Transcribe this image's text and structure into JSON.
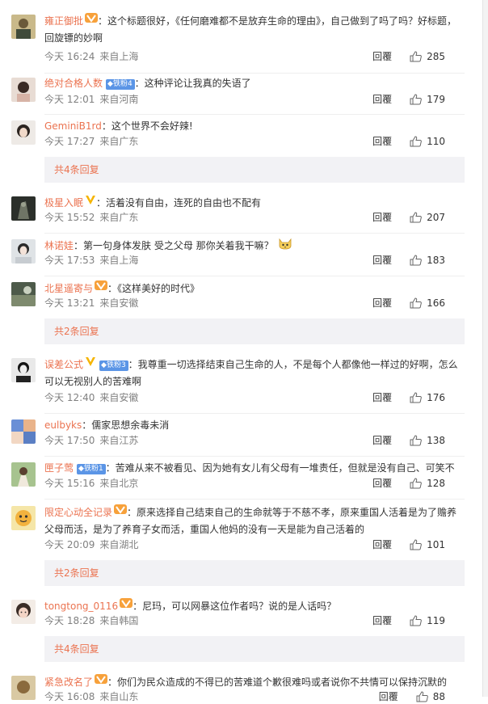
{
  "comments": [
    {
      "user": "雍正御批",
      "badge": "vip",
      "fan": "",
      "text": "：这个标题很好，《任何磨难都不是放弃生命的理由》，自己做到了吗了吗？好标题，",
      "text2": "回旋镖的妙啊",
      "time": "今天 16:24",
      "source": "来自上海",
      "reply": "回覆",
      "likes": "285",
      "avatar": "avatar-1"
    },
    {
      "user": "绝对合格人数",
      "badge": "",
      "fan": "铁粉4",
      "text": "：这种评论让我真的失语了",
      "text2": "",
      "time": "今天 12:01",
      "source": "来自河南",
      "reply": "回覆",
      "likes": "179",
      "avatar": "avatar-2"
    },
    {
      "user": "GeminiB1rd",
      "badge": "",
      "fan": "",
      "text": "：这个世界不会好辣!",
      "text2": "",
      "time": "今天 17:27",
      "source": "来自广东",
      "reply": "回覆",
      "likes": "110",
      "avatar": "avatar-3"
    },
    {
      "user": "极星入眠",
      "badge": "v",
      "fan": "",
      "text": "：活着没有自由，连死的自由也不配有",
      "text2": "",
      "time": "今天 15:52",
      "source": "来自广东",
      "reply": "回覆",
      "likes": "207",
      "avatar": "avatar-4"
    },
    {
      "user": "林诺娃",
      "badge": "",
      "fan": "",
      "text": "：第一句身体发肤 受之父母 那你关着我干嘛？",
      "text2": "",
      "time": "今天 17:53",
      "source": "来自上海",
      "reply": "回覆",
      "likes": "183",
      "avatar": "avatar-5",
      "emoji": true
    },
    {
      "user": "北星遥寄与",
      "badge": "vip",
      "fan": "",
      "text": "：《这样美好的时代》",
      "text2": "",
      "time": "今天 13:21",
      "source": "来自安徽",
      "reply": "回覆",
      "likes": "166",
      "avatar": "avatar-6"
    },
    {
      "user": "误差公式",
      "badge": "v",
      "fan": "铁粉3",
      "text": "：我尊重一切选择结束自己生命的人，不是每个人都像他一样过的好啊，怎么",
      "text2": "可以无视别人的苦难啊",
      "time": "今天 12:40",
      "source": "来自安徽",
      "reply": "回覆",
      "likes": "176",
      "avatar": "avatar-7"
    },
    {
      "user": "eulbyks",
      "badge": "",
      "fan": "",
      "text": "：儒家思想余毒未消",
      "text2": "",
      "time": "今天 17:50",
      "source": "来自江苏",
      "reply": "回覆",
      "likes": "138",
      "avatar": "avatar-8"
    },
    {
      "user": "匣子莺",
      "badge": "",
      "fan": "铁粉1",
      "text": "：苦难从来不被看见、因为她有女儿有父母有一堆责任，但就是没有自己、可笑不",
      "text2": "",
      "time": "今天 15:16",
      "source": "来自北京",
      "reply": "回覆",
      "likes": "128",
      "avatar": "avatar-9"
    },
    {
      "user": "限定心动全记录",
      "badge": "vip",
      "fan": "",
      "text": "：原来选择自己结束自己的生命就等于不慈不孝，原来重国人活着是为了赡养",
      "text2": "父母而活，是为了养育子女而活，重国人他妈的没有一天是能为自己活着的",
      "time": "今天 20:09",
      "source": "来自湖北",
      "reply": "回覆",
      "likes": "101",
      "avatar": "avatar-10"
    },
    {
      "user": "tongtong_0116",
      "badge": "vip",
      "fan": "",
      "text": "：尼玛，可以网暴这位作者吗？说的是人话吗？",
      "text2": "",
      "time": "今天 18:28",
      "source": "来自韩国",
      "reply": "回覆",
      "likes": "119",
      "avatar": "avatar-11"
    },
    {
      "user": "紧急改名了",
      "badge": "vip",
      "fan": "",
      "text": "：你们为民众造成的不得已的苦难道个歉很难吗或者说你不共情可以保持沉默的",
      "text2": "",
      "time": "今天 16:08",
      "source": "来自山东",
      "reply": "回覆",
      "likes": "88",
      "avatar": "avatar-12"
    }
  ],
  "more_replies": [
    "共4条回复",
    "共2条回复",
    "共2条回复",
    "共4条回复"
  ],
  "colors": {
    "username": "#eb7350",
    "meta": "#808080",
    "more_bg": "#f2f2f5",
    "fan_badge": "#5b95e6"
  }
}
